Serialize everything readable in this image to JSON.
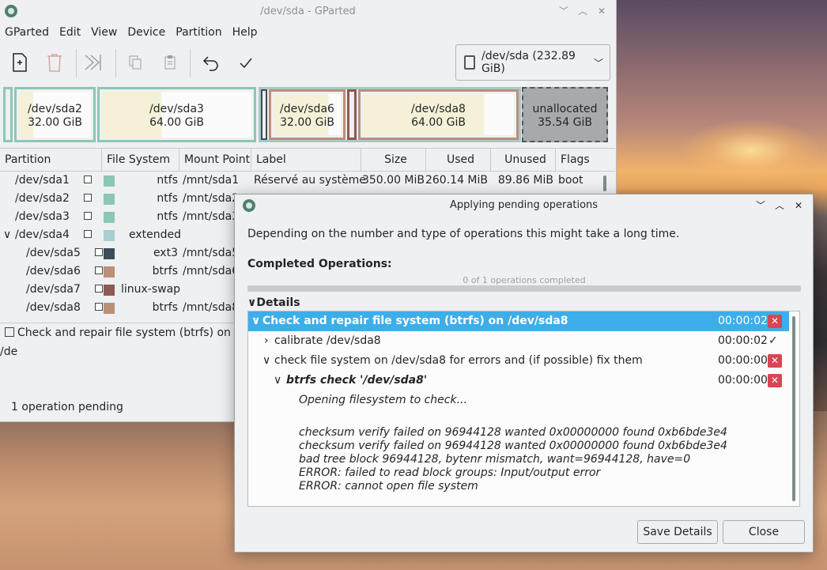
{
  "main": {
    "title": "/dev/sda - GParted",
    "menu": [
      "GParted",
      "Edit",
      "View",
      "Device",
      "Partition",
      "Help"
    ],
    "device_selector": "/dev/sda (232.89 GiB)",
    "diskmap": [
      {
        "name": "/dev/sda2",
        "size": "32.00 GiB"
      },
      {
        "name": "/dev/sda3",
        "size": "64.00 GiB"
      },
      {
        "name": "/dev/sda6",
        "size": "32.00 GiB"
      },
      {
        "name": "/dev/sda8",
        "size": "64.00 GiB"
      },
      {
        "name": "unallocated",
        "size": "35.54 GiB"
      }
    ],
    "columns": [
      "Partition",
      "File System",
      "Mount Point",
      "Label",
      "Size",
      "Used",
      "Unused",
      "Flags"
    ],
    "rows": [
      {
        "partition": "/dev/sda1",
        "fs": "ntfs",
        "mount": "/mnt/sda1",
        "label": "Réservé au système",
        "size": "350.00 MiB",
        "used": "260.14 MiB",
        "unused": "89.86 MiB",
        "flags": "boot",
        "color": "#8cc7b5"
      },
      {
        "partition": "/dev/sda2",
        "fs": "ntfs",
        "mount": "/mnt/sda2",
        "label": "",
        "size": "",
        "used": "",
        "unused": "",
        "flags": "",
        "color": "#8cc7b5"
      },
      {
        "partition": "/dev/sda3",
        "fs": "ntfs",
        "mount": "/mnt/sda3",
        "label": "",
        "size": "",
        "used": "",
        "unused": "",
        "flags": "",
        "color": "#8cc7b5"
      },
      {
        "partition": "/dev/sda4",
        "fs": "extended",
        "mount": "",
        "label": "",
        "size": "",
        "used": "",
        "unused": "",
        "flags": "",
        "color": "#a8cfd0"
      },
      {
        "partition": "/dev/sda5",
        "fs": "ext3",
        "mount": "/mnt/sda5",
        "label": "",
        "size": "",
        "used": "",
        "unused": "",
        "flags": "",
        "color": "#3b4c5a"
      },
      {
        "partition": "/dev/sda6",
        "fs": "btrfs",
        "mount": "/mnt/sda6",
        "label": "",
        "size": "",
        "used": "",
        "unused": "",
        "flags": "",
        "color": "#b9907a"
      },
      {
        "partition": "/dev/sda7",
        "fs": "linux-swap",
        "mount": "",
        "label": "",
        "size": "",
        "used": "",
        "unused": "",
        "flags": "",
        "color": "#8b5a52"
      },
      {
        "partition": "/dev/sda8",
        "fs": "btrfs",
        "mount": "/mnt/sda8",
        "label": "",
        "size": "",
        "used": "",
        "unused": "",
        "flags": "",
        "color": "#b9907a"
      }
    ],
    "pending_op": "Check and repair file system (btrfs) on /de",
    "status": "1 operation pending"
  },
  "dialog": {
    "title": "Applying pending operations",
    "intro": "Depending on the number and type of operations this might take a long time.",
    "completed_label": "Completed Operations:",
    "progress_text": "0 of 1 operations completed",
    "details_label": "Details",
    "op_title": "Check and repair file system (btrfs) on /dev/sda8",
    "op_time": "00:00:02",
    "step1": "calibrate /dev/sda8",
    "step1_time": "00:00:02",
    "step2": "check file system on /dev/sda8 for errors and (if possible) fix them",
    "step2_time": "00:00:00",
    "cmd": "btrfs check '/dev/sda8'",
    "cmd_time": "00:00:00",
    "out1": "Opening filesystem to check...",
    "out_lines": [
      "checksum verify failed on 96944128 wanted 0x00000000 found 0xb6bde3e4",
      "checksum verify failed on 96944128 wanted 0x00000000 found 0xb6bde3e4",
      "bad tree block 96944128, bytenr mismatch, want=96944128, have=0",
      "ERROR: failed to read block groups: Input/output error",
      "ERROR: cannot open file system"
    ],
    "save_label": "Save Details",
    "close_label": "Close"
  }
}
